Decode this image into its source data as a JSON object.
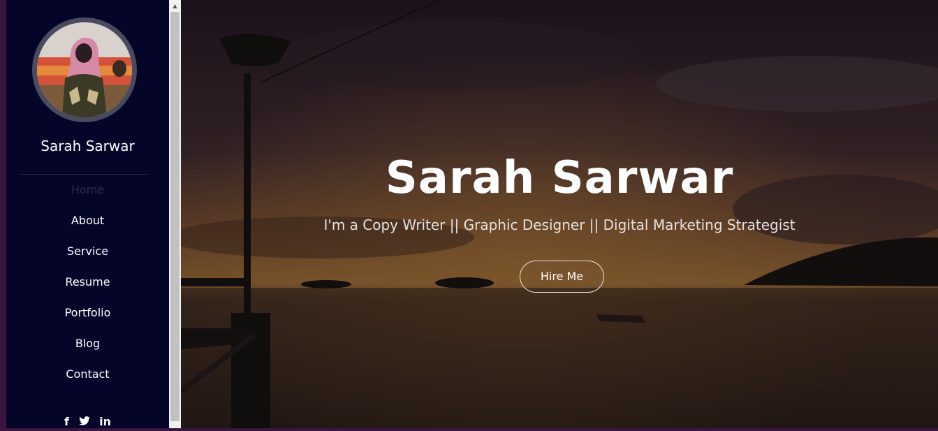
{
  "sidebar": {
    "name": "Sarah Sarwar",
    "nav": [
      {
        "label": "Home",
        "active": true
      },
      {
        "label": "About",
        "active": false
      },
      {
        "label": "Service",
        "active": false
      },
      {
        "label": "Resume",
        "active": false
      },
      {
        "label": "Portfolio",
        "active": false
      },
      {
        "label": "Blog",
        "active": false
      },
      {
        "label": "Contact",
        "active": false
      }
    ],
    "social": {
      "facebook": "f",
      "twitter": "🐦",
      "linkedin": "in"
    }
  },
  "hero": {
    "title": "Sarah Sarwar",
    "subtitle": "I'm a Copy Writer || Graphic Designer || Digital Marketing Strategist",
    "button": "Hire Me"
  },
  "colors": {
    "sidebar_bg": "#040528",
    "frame": "#3a1540",
    "active_nav": "#2c2d4a"
  },
  "icons": [
    "avatar-photo",
    "facebook-icon",
    "twitter-icon",
    "linkedin-icon",
    "scroll-up-arrow-icon"
  ]
}
